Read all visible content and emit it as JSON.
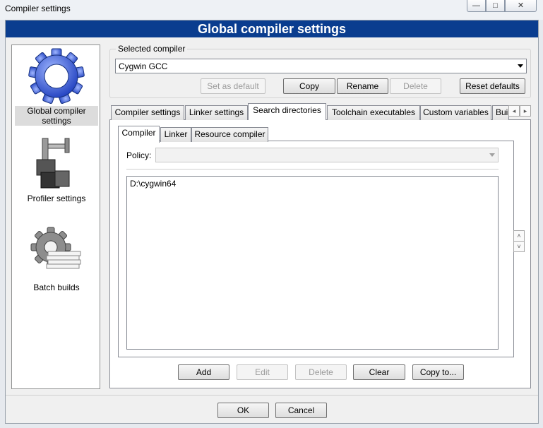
{
  "window": {
    "title": "Compiler settings",
    "controls": {
      "minimize": "—",
      "maximize": "□",
      "close": "✕"
    }
  },
  "banner": "Global compiler settings",
  "nav": [
    {
      "label": "Global compiler settings",
      "icon": "gear-icon",
      "selected": true
    },
    {
      "label": "Profiler settings",
      "icon": "caliper-icon",
      "selected": false
    },
    {
      "label": "Batch builds",
      "icon": "batch-gear-icon",
      "selected": false
    }
  ],
  "selected_compiler": {
    "group_label": "Selected compiler",
    "value": "Cygwin GCC",
    "buttons": {
      "set_default": "Set as default",
      "copy": "Copy",
      "rename": "Rename",
      "delete": "Delete",
      "reset": "Reset defaults"
    }
  },
  "tabs": [
    "Compiler settings",
    "Linker settings",
    "Search directories",
    "Toolchain executables",
    "Custom variables",
    "Bui"
  ],
  "active_tab": "Search directories",
  "subtabs": [
    "Compiler",
    "Linker",
    "Resource compiler"
  ],
  "active_subtab": "Compiler",
  "policy": {
    "label": "Policy:",
    "value": ""
  },
  "directories": [
    "D:\\cygwin64"
  ],
  "list_buttons": {
    "add": "Add",
    "edit": "Edit",
    "delete": "Delete",
    "clear": "Clear",
    "copy_to": "Copy to..."
  },
  "dialog_buttons": {
    "ok": "OK",
    "cancel": "Cancel"
  },
  "spin": {
    "up": "˄",
    "down": "˅",
    "left": "◂",
    "right": "▸"
  },
  "colors": {
    "banner": "#0a3d8f",
    "gear": "#3355cc"
  }
}
